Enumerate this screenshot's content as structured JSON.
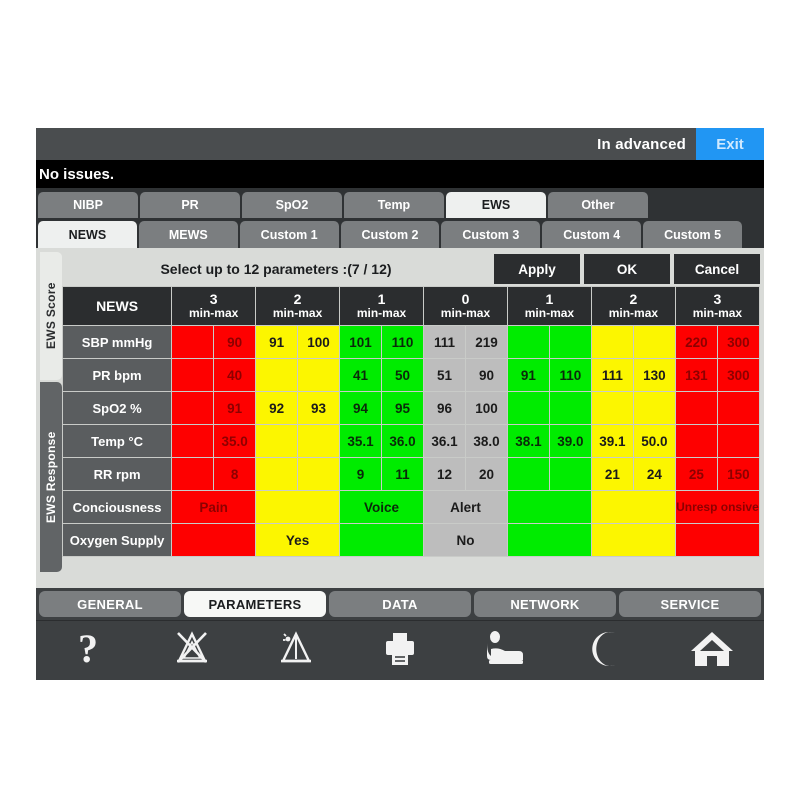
{
  "topbar": {
    "advanced_label": "In advanced",
    "exit_label": "Exit",
    "exit_color": "#2196f3"
  },
  "alarm_bar": {
    "message": "No issues."
  },
  "param_tabs": [
    {
      "label": "NIBP",
      "active": false
    },
    {
      "label": "PR",
      "active": false
    },
    {
      "label": "SpO2",
      "active": false
    },
    {
      "label": "Temp",
      "active": false
    },
    {
      "label": "EWS",
      "active": true
    },
    {
      "label": "Other",
      "active": false
    }
  ],
  "score_tabs": [
    {
      "label": "NEWS",
      "active": true
    },
    {
      "label": "MEWS",
      "active": false
    },
    {
      "label": "Custom 1",
      "active": false
    },
    {
      "label": "Custom 2",
      "active": false
    },
    {
      "label": "Custom 3",
      "active": false
    },
    {
      "label": "Custom 4",
      "active": false
    },
    {
      "label": "Custom 5",
      "active": false
    }
  ],
  "vertical_tabs": [
    {
      "label": "EWS Score",
      "active": true
    },
    {
      "label": "EWS Response",
      "active": false
    }
  ],
  "select_bar": {
    "message": "Select up to 12 parameters :(7 / 12)",
    "apply_label": "Apply",
    "ok_label": "OK",
    "cancel_label": "Cancel"
  },
  "table": {
    "name_header": "NEWS",
    "columns": [
      {
        "score": "3",
        "range": "min-max",
        "color": "#fe0000"
      },
      {
        "score": "2",
        "range": "min-max",
        "color": "#fcf600"
      },
      {
        "score": "1",
        "range": "min-max",
        "color": "#00ec00"
      },
      {
        "score": "0",
        "range": "min-max",
        "color": "#bdbdbd"
      },
      {
        "score": "1",
        "range": "min-max",
        "color": "#00ec00"
      },
      {
        "score": "2",
        "range": "min-max",
        "color": "#fcf600"
      },
      {
        "score": "3",
        "range": "min-max",
        "color": "#fe0000"
      }
    ],
    "rows": [
      {
        "label": "SBP mmHg",
        "cells": [
          "",
          "90",
          "91",
          "100",
          "101",
          "110",
          "111",
          "219",
          "",
          "",
          "",
          "",
          "220",
          "300"
        ]
      },
      {
        "label": "PR bpm",
        "cells": [
          "",
          "40",
          "",
          "",
          "41",
          "50",
          "51",
          "90",
          "91",
          "110",
          "111",
          "130",
          "131",
          "300"
        ]
      },
      {
        "label": "SpO2 %",
        "cells": [
          "",
          "91",
          "92",
          "93",
          "94",
          "95",
          "96",
          "100",
          "",
          "",
          "",
          "",
          "",
          ""
        ]
      },
      {
        "label": "Temp °C",
        "cells": [
          "",
          "35.0",
          "",
          "",
          "35.1",
          "36.0",
          "36.1",
          "38.0",
          "38.1",
          "39.0",
          "39.1",
          "50.0",
          "",
          ""
        ]
      },
      {
        "label": "RR rpm",
        "cells": [
          "",
          "8",
          "",
          "",
          "9",
          "11",
          "12",
          "20",
          "",
          "",
          "21",
          "24",
          "25",
          "150"
        ]
      },
      {
        "label": "Conciousness",
        "merged": true,
        "cells": [
          "Pain",
          "",
          "Voice",
          "Alert",
          "",
          "",
          "Unresp onsive"
        ]
      },
      {
        "label": "Oxygen Supply",
        "merged": true,
        "cells": [
          "",
          "Yes",
          "",
          "No",
          "",
          "",
          ""
        ]
      }
    ]
  },
  "bottom_tabs": [
    {
      "label": "GENERAL",
      "active": false
    },
    {
      "label": "PARAMETERS",
      "active": true
    },
    {
      "label": "DATA",
      "active": false
    },
    {
      "label": "NETWORK",
      "active": false
    },
    {
      "label": "SERVICE",
      "active": false
    }
  ],
  "icon_bar": [
    {
      "name": "help-icon",
      "glyph": "?"
    },
    {
      "name": "alarm-off-icon",
      "glyph": ""
    },
    {
      "name": "alarm-pause-icon",
      "glyph": ""
    },
    {
      "name": "printer-icon",
      "glyph": ""
    },
    {
      "name": "patient-bed-icon",
      "glyph": ""
    },
    {
      "name": "night-mode-icon",
      "glyph": ""
    },
    {
      "name": "home-icon",
      "glyph": ""
    }
  ]
}
